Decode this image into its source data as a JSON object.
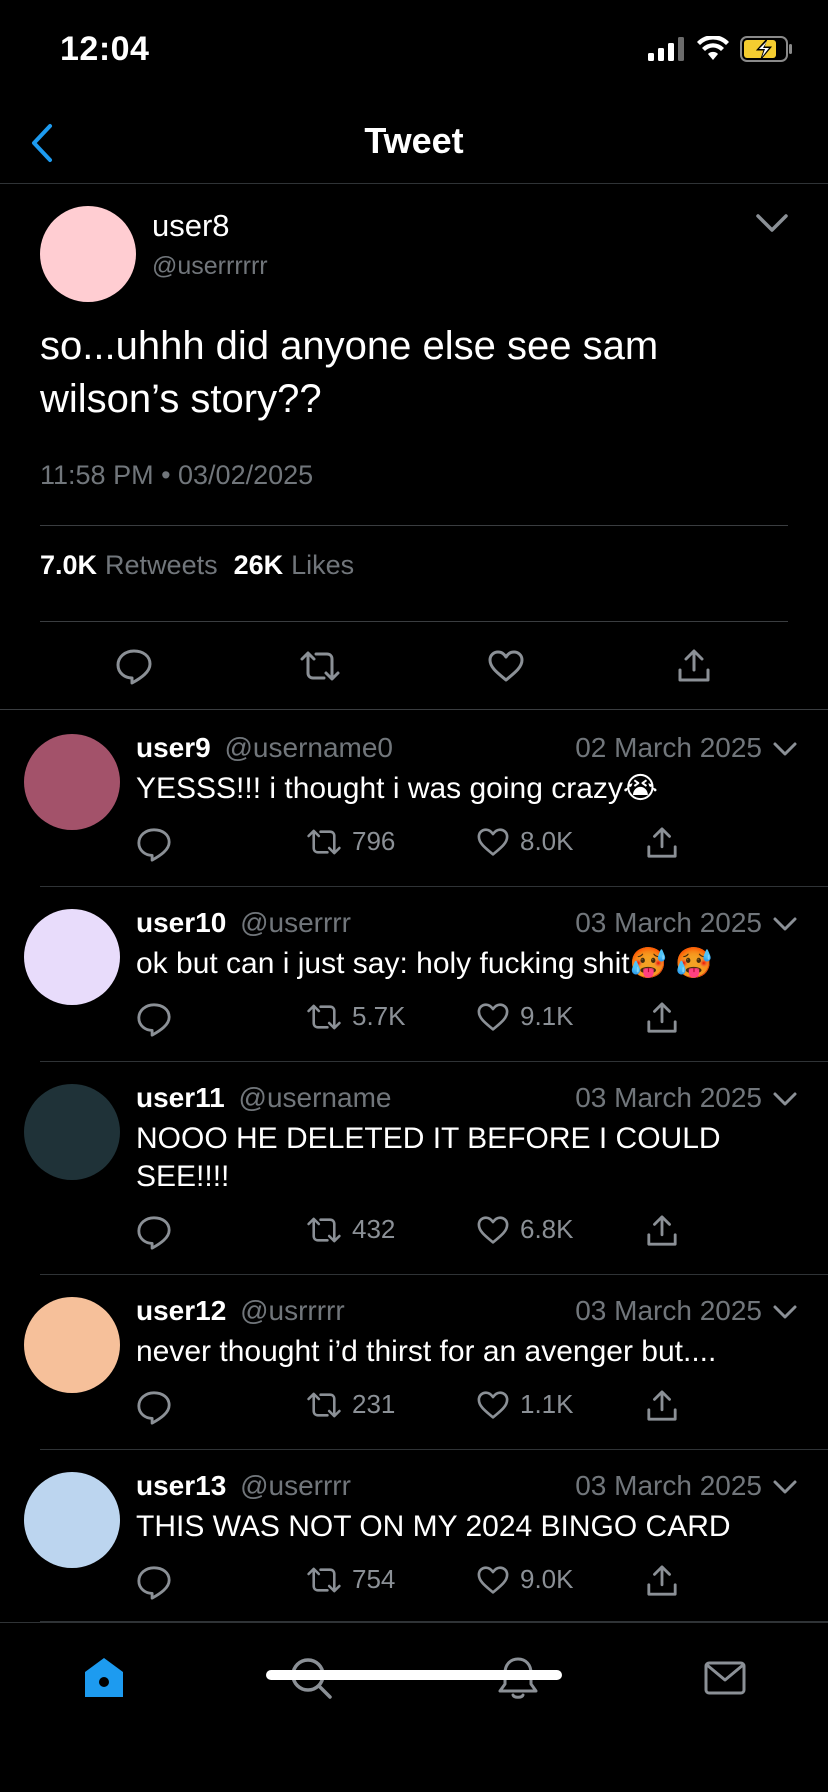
{
  "status_bar": {
    "time": "12:04",
    "battery_color": "#f5cd30"
  },
  "header": {
    "title": "Tweet",
    "back_icon": "chevron-left-icon",
    "accent_color": "#1d9bf0"
  },
  "main_tweet": {
    "display_name": "user8",
    "handle": "@userrrrrr",
    "avatar_color": "#ffcdd2",
    "text": "so...uhhh did anyone else see sam wilson’s story??",
    "timestamp": "11:58 PM • 03/02/2025",
    "retweets_count": "7.0K",
    "retweets_label": "Retweets",
    "likes_count": "26K",
    "likes_label": "Likes",
    "actions": [
      "reply-icon",
      "retweet-icon",
      "like-icon",
      "share-icon"
    ]
  },
  "replies": [
    {
      "display_name": "user9",
      "handle": "@username0",
      "date": "02 March 2025",
      "text": "YESSS!!! i thought i was going crazy😭",
      "retweets": "796",
      "likes": "8.0K",
      "avatar_color": "#a3526a"
    },
    {
      "display_name": "user10",
      "handle": "@userrrr",
      "date": "03 March 2025",
      "text": "ok but can i just say: holy fucking shit🥵 🥵",
      "retweets": "5.7K",
      "likes": "9.1K",
      "avatar_color": "#e8dcfb"
    },
    {
      "display_name": "user11",
      "handle": "@username",
      "date": "03 March 2025",
      "text": "NOOO HE DELETED IT BEFORE I COULD SEE!!!!",
      "retweets": "432",
      "likes": "6.8K",
      "avatar_color": "#1f3238"
    },
    {
      "display_name": "user12",
      "handle": "@usrrrrr",
      "date": "03 March 2025",
      "text": "never thought i’d thirst for an avenger but....",
      "retweets": "231",
      "likes": "1.1K",
      "avatar_color": "#f6c09a"
    },
    {
      "display_name": "user13",
      "handle": "@userrrr",
      "date": "03 March 2025",
      "text": "THIS WAS NOT ON MY 2024 BINGO CARD",
      "retweets": "754",
      "likes": "9.0K",
      "avatar_color": "#bcd5ef"
    }
  ],
  "tab_bar": {
    "tabs": [
      "home-icon",
      "search-icon",
      "notifications-icon",
      "messages-icon"
    ],
    "active_tab": "home-icon"
  }
}
